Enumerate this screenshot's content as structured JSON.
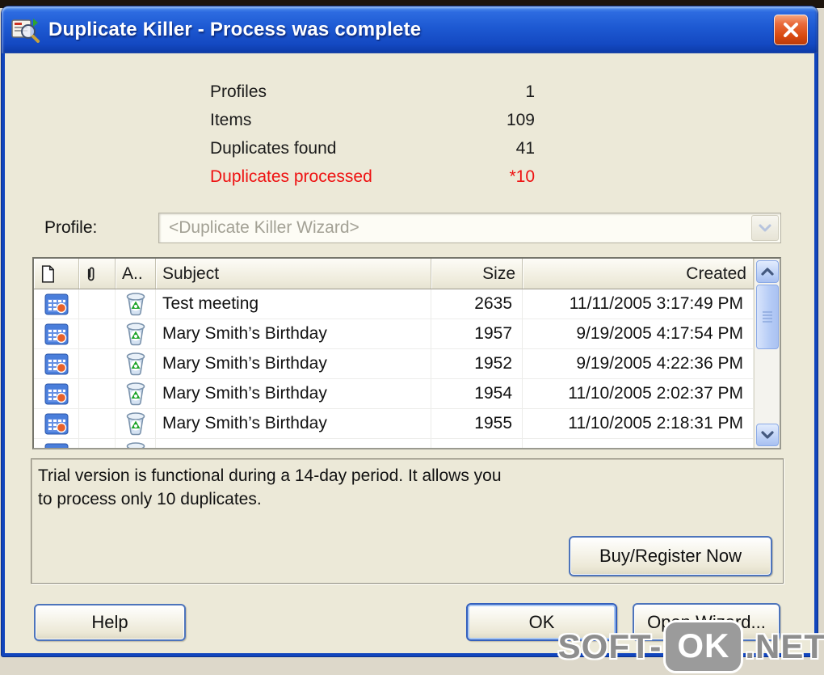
{
  "window": {
    "title": "Duplicate Killer - Process was complete"
  },
  "stats": {
    "rows": [
      {
        "label": "Profiles",
        "value": "1"
      },
      {
        "label": "Items",
        "value": "109"
      },
      {
        "label": "Duplicates found",
        "value": "41"
      },
      {
        "label": "Duplicates processed",
        "value": "*10"
      }
    ]
  },
  "profile": {
    "label": "Profile:",
    "value": "<Duplicate Killer Wizard>"
  },
  "table": {
    "columns": [
      {
        "name": "item-type",
        "label": "",
        "icon": "document-icon"
      },
      {
        "name": "attachment",
        "label": "",
        "icon": "paperclip-icon"
      },
      {
        "name": "action",
        "label": "A.."
      },
      {
        "name": "subject",
        "label": "Subject"
      },
      {
        "name": "size",
        "label": "Size"
      },
      {
        "name": "created",
        "label": "Created"
      }
    ],
    "rows": [
      {
        "subject": "Test meeting",
        "size": "2635",
        "created": "11/11/2005 3:17:49 PM"
      },
      {
        "subject": "Mary Smith’s Birthday",
        "size": "1957",
        "created": "9/19/2005 4:17:54 PM"
      },
      {
        "subject": "Mary Smith’s Birthday",
        "size": "1952",
        "created": "9/19/2005 4:22:36 PM"
      },
      {
        "subject": "Mary Smith’s Birthday",
        "size": "1954",
        "created": "11/10/2005 2:02:37 PM"
      },
      {
        "subject": "Mary Smith’s Birthday",
        "size": "1955",
        "created": "11/10/2005 2:18:31 PM"
      }
    ]
  },
  "trial": {
    "line1": "Trial version is functional during a 14-day period. It allows you",
    "line2": "to process only 10 duplicates.",
    "buy_button": "Buy/Register Now"
  },
  "buttons": {
    "help": "Help",
    "ok": "OK",
    "open_wizard": "Open Wizard..."
  },
  "watermark": {
    "prefix": "SOFT-",
    "badge": "OK",
    "suffix": ".NET"
  },
  "colors": {
    "titlebar_blue": "#1d59d2",
    "dialog_bg": "#ece9d8",
    "highlight_red": "#ee1111",
    "close_button_red": "#d8490f",
    "scrollbar_blue": "#b6ccf6"
  }
}
